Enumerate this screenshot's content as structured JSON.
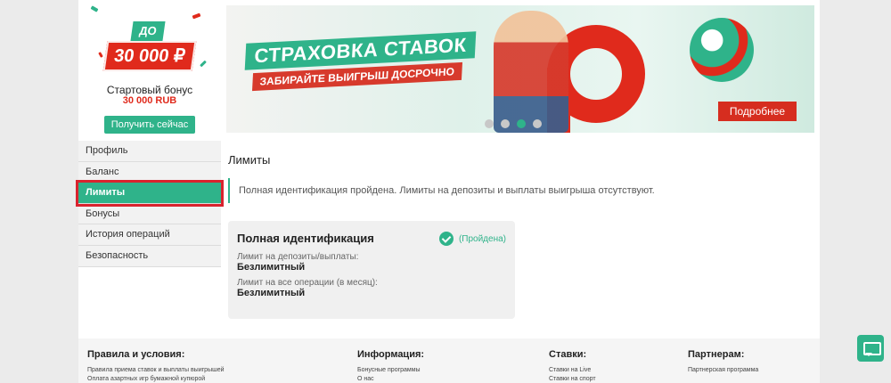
{
  "colors": {
    "brand_green": "#2fb38a",
    "brand_red": "#e02a1c",
    "highlight_red": "#d9232e"
  },
  "promo": {
    "prefix": "ДО",
    "amount": "30 000 ₽",
    "title": "Стартовый бонус",
    "sum": "30 000 RUB",
    "cta_label": "Получить сейчас"
  },
  "banner": {
    "headline": "СТРАХОВКА СТАВОК",
    "subheadline": "ЗАБИРАЙТЕ ВЫИГРЫШ ДОСРОЧНО",
    "more_label": "Подробнее",
    "slides_total": 4,
    "active_slide": 3
  },
  "sidebar": {
    "items": [
      {
        "label": "Профиль"
      },
      {
        "label": "Баланс"
      },
      {
        "label": "Лимиты",
        "active": true
      },
      {
        "label": "Бонусы"
      },
      {
        "label": "История операций"
      },
      {
        "label": "Безопасность"
      }
    ]
  },
  "main": {
    "title": "Лимиты",
    "notice": "Полная идентификация пройдена. Лимиты на депозиты и выплаты выигрыша отсутствуют.",
    "card": {
      "title": "Полная идентификация",
      "status": "(Пройдена)",
      "limits": [
        {
          "label": "Лимит на депозиты/выплаты:",
          "value": "Безлимитный"
        },
        {
          "label": "Лимит на все операции (в месяц):",
          "value": "Безлимитный"
        }
      ]
    }
  },
  "footer": {
    "rules": {
      "heading": "Правила и условия:",
      "links": [
        "Правила приема ставок и выплаты выигрышей",
        "Оплата азартных игр бумажной купюрой"
      ]
    },
    "info": {
      "heading": "Информация:",
      "links": [
        "Бонусные программы",
        "О нас"
      ]
    },
    "bets": {
      "heading": "Ставки:",
      "links": [
        "Ставки на Live",
        "Ставки на спорт"
      ]
    },
    "partners": {
      "heading": "Партнерам:",
      "links": [
        "Партнерская программа"
      ]
    }
  }
}
